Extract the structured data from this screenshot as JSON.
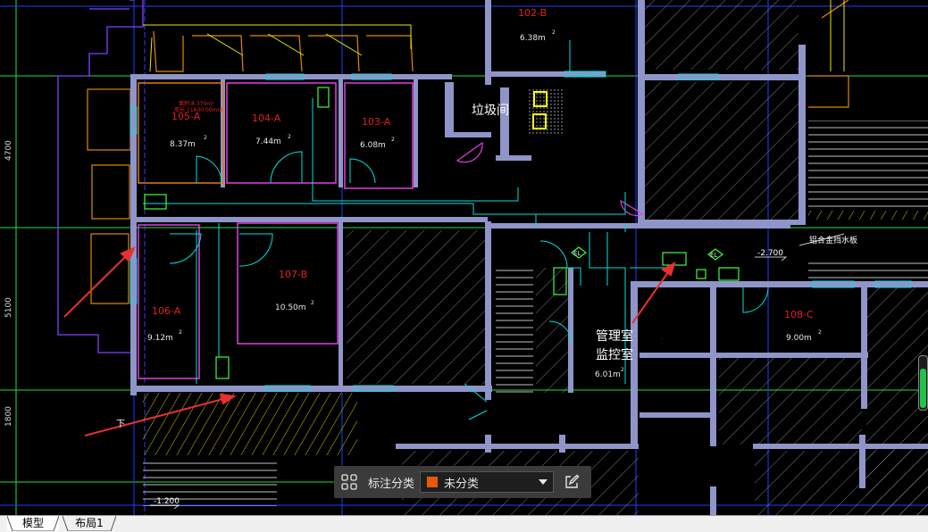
{
  "drawing": {
    "rooms": [
      {
        "name": "102-B",
        "area": "6.38m"
      },
      {
        "name": "105-A",
        "area": "8.37m"
      },
      {
        "name": "104-A",
        "area": "7.44m"
      },
      {
        "name": "103-A",
        "area": "6.08m"
      },
      {
        "name": "107-B",
        "area": "10.50m"
      },
      {
        "name": "106-A",
        "area": "9.12m"
      },
      {
        "name": "108-C",
        "area": "9.00m"
      },
      {
        "name": "",
        "area": "6.01m"
      }
    ],
    "labels": {
      "garbage_room": "垃圾间",
      "mgmt_room": "管理室",
      "monitor_room": "监控室",
      "aluminum_louver": "铝合金挡水板",
      "down": "下",
      "level_1": "-2.700",
      "level_2": "-1.200",
      "el_1": "EL",
      "el_2": "EL",
      "sup": "2",
      "selection_note_1": "面积:8.370m²",
      "selection_note_2": "周长:11600.00mm"
    },
    "dimensions": [
      "4700",
      "5100",
      "1800"
    ],
    "colors": {
      "background": "#000000",
      "wall": "#8f95c8",
      "room_red": "#e02020",
      "cyan": "#00e0e0",
      "green": "#3cff3c",
      "magenta": "#e040e0",
      "yellow": "#ffff00",
      "orange": "#e08a00",
      "blue": "#2040ff",
      "arrow_red": "#e83030"
    }
  },
  "toolbar": {
    "grid_icon": "grid-icon",
    "label": "标注分类",
    "category_value": "未分类",
    "category_color": "#e8580c",
    "edit_icon": "edit-icon"
  },
  "tabs": [
    {
      "label": "模型",
      "active": true
    },
    {
      "label": "布局1",
      "active": false
    }
  ]
}
